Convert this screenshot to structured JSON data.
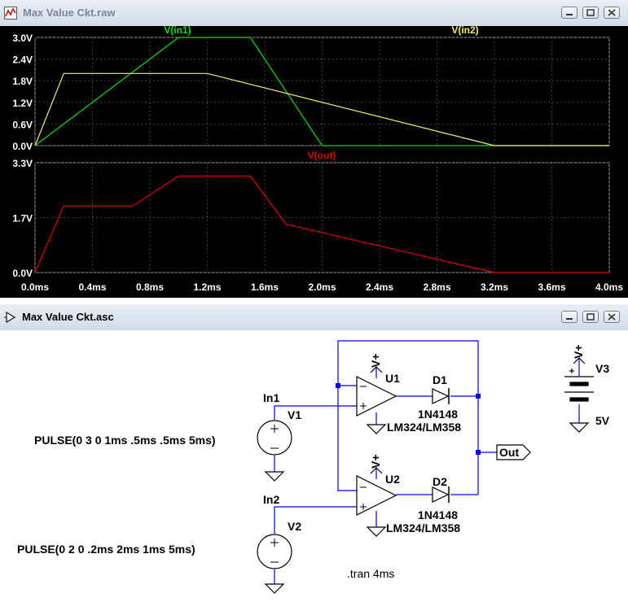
{
  "waveform_window": {
    "title": "Max Value Ckt.raw",
    "top_pane": {
      "y_ticks": [
        "3.0V",
        "2.4V",
        "1.8V",
        "1.2V",
        "0.6V",
        "0.0V"
      ],
      "traces": [
        {
          "label": "V(in1)",
          "color": "#00e000"
        },
        {
          "label": "V(in2)",
          "color": "#f0f060"
        }
      ]
    },
    "bottom_pane": {
      "y_ticks": [
        "3.3V",
        "1.7V",
        "0.0V"
      ],
      "traces": [
        {
          "label": "V(out)",
          "color": "#e00000"
        }
      ]
    },
    "x_ticks": [
      "0.0ms",
      "0.4ms",
      "0.8ms",
      "1.2ms",
      "1.6ms",
      "2.0ms",
      "2.4ms",
      "2.8ms",
      "3.2ms",
      "3.6ms",
      "4.0ms"
    ]
  },
  "chart_data": [
    {
      "type": "line",
      "x_unit": "ms",
      "xlim": [
        0,
        4
      ],
      "ylim": [
        0,
        3
      ],
      "series": [
        {
          "name": "V(in1)",
          "color": "#00e000",
          "x": [
            0,
            1.0,
            1.5,
            2.0,
            4.0
          ],
          "y": [
            0,
            3.0,
            3.0,
            0,
            0
          ]
        },
        {
          "name": "V(in2)",
          "color": "#f0f060",
          "x": [
            0,
            0.2,
            1.2,
            3.2,
            4.0
          ],
          "y": [
            0,
            2.0,
            2.0,
            0,
            0
          ]
        }
      ]
    },
    {
      "type": "line",
      "x_unit": "ms",
      "xlim": [
        0,
        4
      ],
      "ylim": [
        0,
        3.3
      ],
      "series": [
        {
          "name": "V(out)",
          "color": "#e00000",
          "x": [
            0,
            0.2,
            0.68,
            1.0,
            1.5,
            1.75,
            2.0,
            3.2,
            4.0
          ],
          "y": [
            0,
            2.0,
            2.0,
            2.9,
            2.9,
            1.45,
            1.2,
            0,
            0
          ]
        }
      ]
    }
  ],
  "schematic_window": {
    "title": "Max Value Ckt.asc",
    "labels": {
      "in1": "In1",
      "in2": "In2",
      "v1": "V1",
      "v2": "V2",
      "v1_value": "PULSE(0 3 0 1ms .5ms .5ms 5ms)",
      "v2_value": "PULSE(0 2 0 .2ms 2ms 1ms 5ms)",
      "u1": "U1",
      "u2": "U2",
      "u_model_1": "LM324/LM358",
      "u_model_2": "LM324/LM358",
      "d1": "D1",
      "d2": "D2",
      "d_model_1": "1N4148",
      "d_model_2": "1N4148",
      "vplus_u1": "V+",
      "vplus_u2": "V+",
      "vplus_v3": "V+",
      "v3": "V3",
      "v3_value": "5V",
      "out": "Out",
      "tran": ".tran 4ms"
    }
  }
}
